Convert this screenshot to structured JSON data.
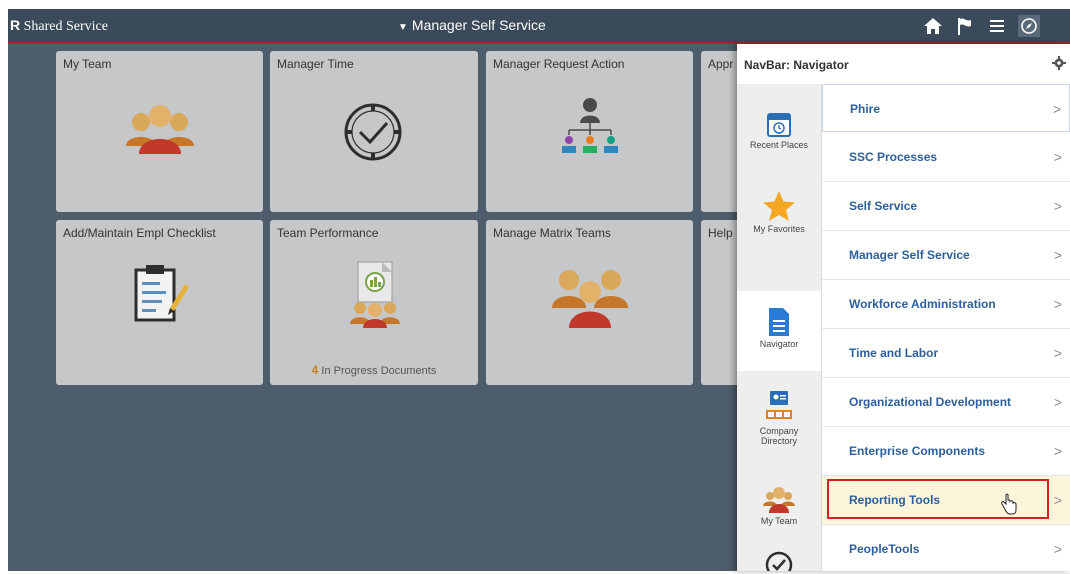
{
  "header": {
    "brand_letter": "R",
    "brand_text": "Shared Service",
    "page_title": "Manager Self Service",
    "icons": [
      "home-icon",
      "flag-icon",
      "menu-icon",
      "navbar-compass-icon"
    ]
  },
  "tiles": [
    {
      "title": "My Team"
    },
    {
      "title": "Manager Time"
    },
    {
      "title": "Manager Request Action"
    },
    {
      "title": "Appr"
    },
    {
      "title": "Add/Maintain Empl Checklist"
    },
    {
      "title": "Team Performance",
      "badge_count": "4",
      "badge_text": "In Progress Documents"
    },
    {
      "title": "Manage Matrix Teams"
    },
    {
      "title": "Help"
    }
  ],
  "navbar": {
    "title": "NavBar: Navigator",
    "rail": [
      {
        "label": "Recent Places"
      },
      {
        "label": "My Favorites"
      },
      {
        "label": "Navigator"
      },
      {
        "label_1": "Company",
        "label_2": "Directory"
      },
      {
        "label": "My Team"
      }
    ],
    "menu": [
      {
        "label": "Phire"
      },
      {
        "label": "SSC Processes"
      },
      {
        "label": "Self Service"
      },
      {
        "label": "Manager Self Service"
      },
      {
        "label": "Workforce Administration"
      },
      {
        "label": "Time and Labor"
      },
      {
        "label": "Organizational Development"
      },
      {
        "label": "Enterprise Components"
      },
      {
        "label": "Reporting Tools"
      },
      {
        "label": "PeopleTools"
      }
    ],
    "chevron": ">"
  },
  "colors": {
    "header_bg": "#3b4a5a",
    "content_bg": "#4d5d6b",
    "tile_bg": "#c6c7c8",
    "link_blue": "#2d5f9a",
    "highlight_red": "#d32020"
  }
}
